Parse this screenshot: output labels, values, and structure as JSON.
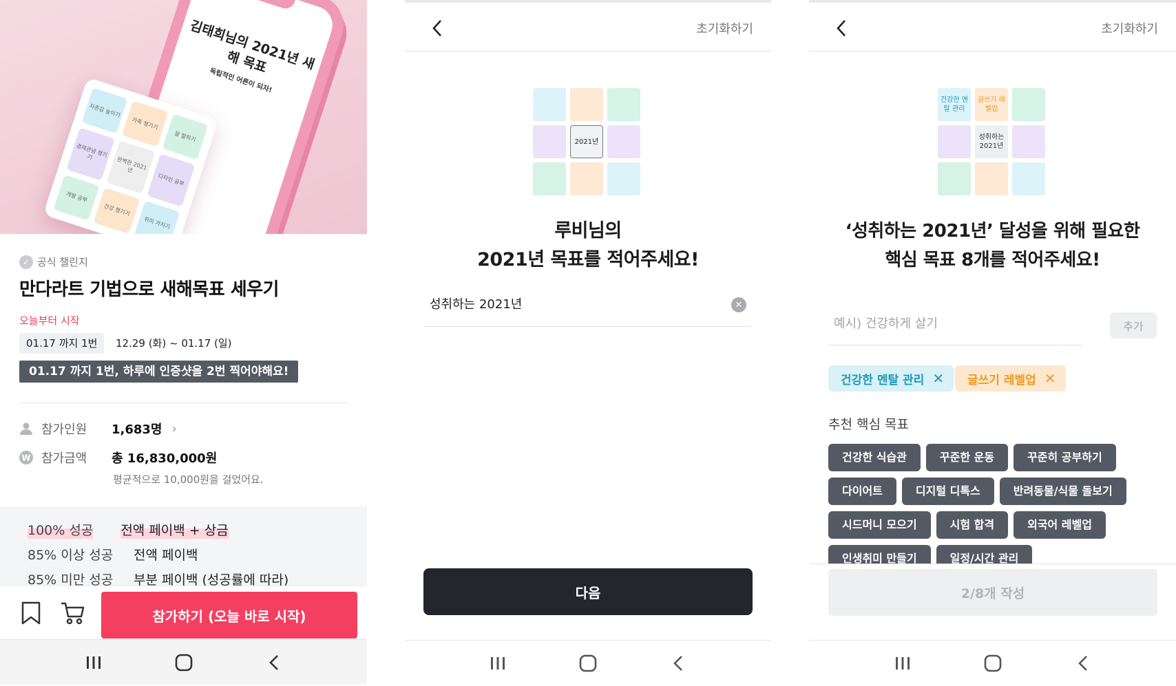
{
  "screen1": {
    "hero": {
      "phone_title": "김태희님의 2021년 새해 목표",
      "phone_subtitle": "독립적인 어른이 되자!",
      "mandala": [
        {
          "label": "자존감 높이기",
          "color": "#cfeef6"
        },
        {
          "label": "가족 챙기기",
          "color": "#fde5cc"
        },
        {
          "label": "잘 할하기",
          "color": "#d3f2e3"
        },
        {
          "label": "경제관념 챙기기",
          "color": "#e5dcf7"
        },
        {
          "label": "완벽한 2021년",
          "color": "#eeeeee"
        },
        {
          "label": "디자인 공부",
          "color": "#e5dcf7"
        },
        {
          "label": "개발 공부",
          "color": "#d3f2e3"
        },
        {
          "label": "건강 챙기기",
          "color": "#fde5cc"
        },
        {
          "label": "취미 가지기",
          "color": "#cfeef6"
        }
      ]
    },
    "official_badge": "공식 챌린지",
    "title": "만다라트 기법으로 새해목표 세우기",
    "start_label": "오늘부터 시작",
    "frequency_chip": "01.17 까지 1번",
    "period": "12.29 (화) ~ 01.17 (일)",
    "rule": "01.17 까지 1번, 하루에 인증샷을 2번 찍어야해요!",
    "participants_label": "참가인원",
    "participants_value": "1,683명",
    "amount_label": "참가금액",
    "amount_value": "총 16,830,000원",
    "amount_note": "평균적으로 10,000원을 걸었어요.",
    "rewards": [
      {
        "label": "100% 성공",
        "value": "전액 페이백 + 상금"
      },
      {
        "label": "85% 이상 성공",
        "value": "전액 페이백"
      },
      {
        "label": "85% 미만 성공",
        "value": "부분 페이백 (성공률에 따라)"
      }
    ],
    "join_button": "참가하기 (오늘 바로 시작)"
  },
  "screen2": {
    "reset": "초기화하기",
    "grid_center": "2021년",
    "heading_line1": "루비님의",
    "heading_line2": "2021년 목표를 적어주세요!",
    "goal_value": "성취하는 2021년",
    "next_button": "다음"
  },
  "screen3": {
    "reset": "초기화하기",
    "grid": {
      "cell0": "건강한 멘탈 관리",
      "cell1": "글쓰기 레벨업",
      "center": "성취하는 2021년"
    },
    "heading_line1": "‘성취하는 2021년’ 달성을 위해 필요한",
    "heading_line2": "핵심 목표 8개를 적어주세요!",
    "input_placeholder": "예시) 건강하게 살기",
    "add_button": "추가",
    "selected": [
      {
        "label": "건강한 멘탈 관리",
        "bg": "#d9f1f7",
        "fg": "#1d9bb8"
      },
      {
        "label": "글쓰기 레벨업",
        "bg": "#fde8cf",
        "fg": "#ef9a25"
      }
    ],
    "recommend_title": "추천 핵심 목표",
    "recommend_rows": [
      [
        "건강한 식습관",
        "꾸준한 운동",
        "꾸준히 공부하기"
      ],
      [
        "다이어트",
        "디지털 디톡스",
        "반려동물/식물 돌보기"
      ],
      [
        "시드머니 모으기",
        "시험 합격",
        "외국어 레벨업"
      ],
      [
        "인생취미 만들기",
        "일정/시간 관리"
      ]
    ],
    "progress_button": "2/8개 작성"
  },
  "colors": {
    "pink_accent": "#f53f60",
    "dark_button": "#23262b",
    "chip_dark": "#545a63",
    "grid_blue": "#dcf3f9",
    "grid_peach": "#fde9d4",
    "grid_mint": "#d5f3e6",
    "grid_lavender": "#ece2f9"
  }
}
